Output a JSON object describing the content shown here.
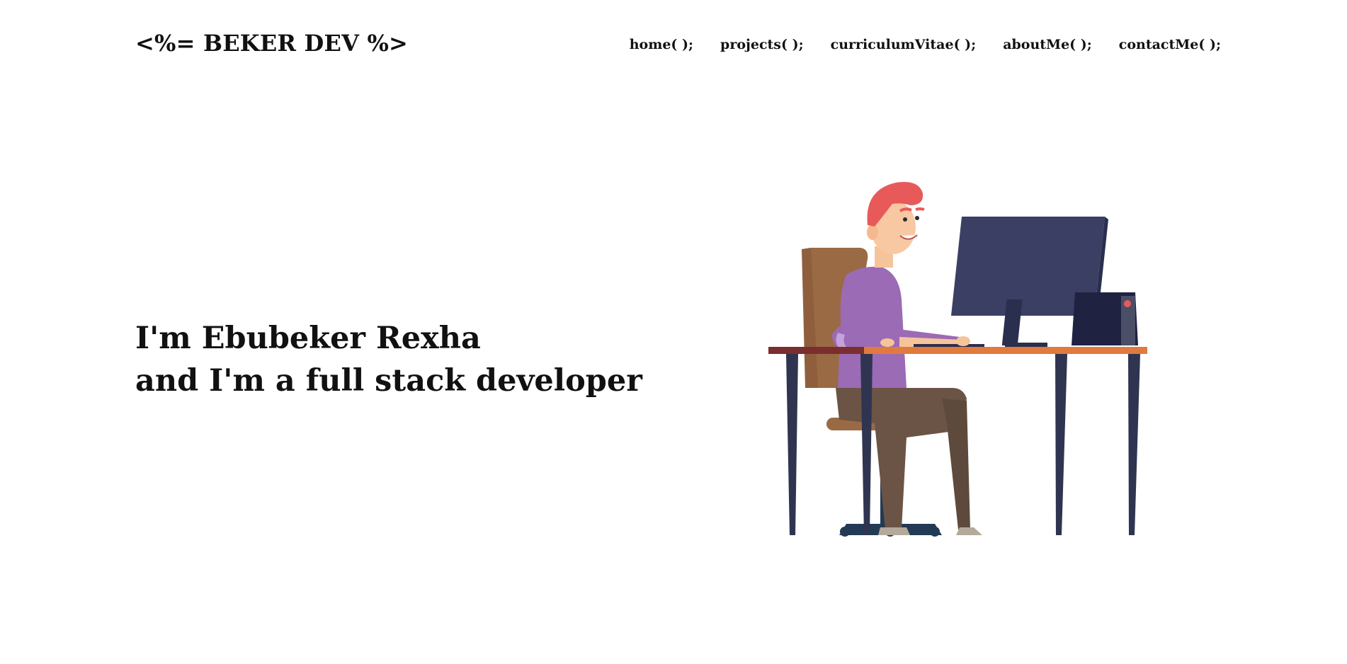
{
  "header": {
    "logo": "<%= BEKER DEV %>",
    "nav": [
      {
        "label": "home( );"
      },
      {
        "label": "projects( );"
      },
      {
        "label": "curriculumVitae( );"
      },
      {
        "label": "aboutMe( );"
      },
      {
        "label": "contactMe( );"
      }
    ]
  },
  "hero": {
    "line1": "I'm Ebubeker Rexha",
    "line2": "and I'm a full stack developer",
    "illustration": "developer-at-desk-illustration"
  },
  "colors": {
    "text": "#111111",
    "background": "#ffffff",
    "monitor": "#3a3f63",
    "desk_top": "#e07a3f",
    "desk_legs": "#2f3550",
    "shirt": "#9b6bb5",
    "hair": "#e85a5a",
    "chair": "#9a6a45",
    "pants": "#6b5445"
  }
}
